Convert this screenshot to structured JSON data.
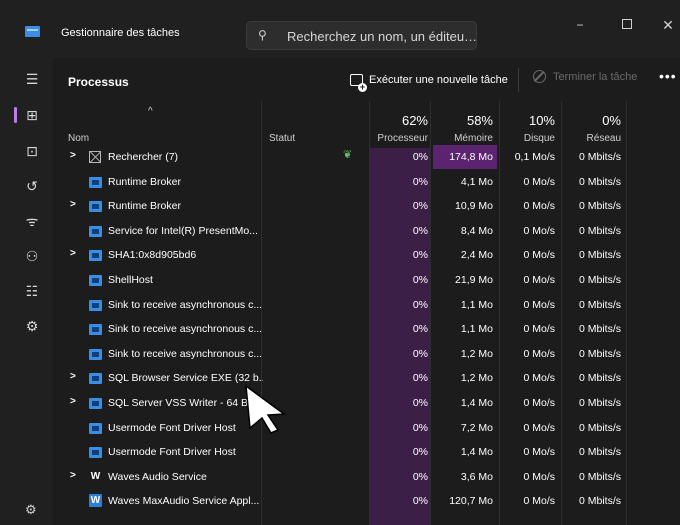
{
  "window": {
    "title": "Gestionnaire des tâches",
    "search_placeholder": "Recherchez un nom, un éditeu…",
    "controls": {
      "minimize": "−",
      "maximize": "",
      "close": "✕"
    }
  },
  "sidebar": {
    "items": [
      {
        "icon": "hamburger-menu-icon",
        "glyph": "☰"
      },
      {
        "icon": "processes-icon",
        "glyph": "⊞"
      },
      {
        "icon": "performance-icon",
        "glyph": "⊡"
      },
      {
        "icon": "app-history-icon",
        "glyph": "↺"
      },
      {
        "icon": "startup-apps-icon",
        "glyph": "ᯤ"
      },
      {
        "icon": "users-icon",
        "glyph": "⚇"
      },
      {
        "icon": "details-icon",
        "glyph": "☷"
      },
      {
        "icon": "services-icon",
        "glyph": "⚙"
      }
    ],
    "settings_icon": "⚙"
  },
  "toolbar": {
    "title": "Processus",
    "run_task": "Exécuter une nouvelle tâche",
    "end_task": "Terminer la tâche",
    "more": "•••"
  },
  "header": {
    "sort_glyph": "^",
    "name": "Nom",
    "status": "Statut",
    "cpu_pct": "62%",
    "cpu_label": "Processeur",
    "mem_pct": "58%",
    "mem_label": "Mémoire",
    "disk_pct": "10%",
    "disk_label": "Disque",
    "net_pct": "0%",
    "net_label": "Réseau"
  },
  "rows": [
    {
      "expand": true,
      "icon": "search",
      "name": "Rechercher (7)",
      "status_icon": true,
      "cpu": "0%",
      "mem": "174,8 Mo",
      "disk": "0,1 Mo/s",
      "net": "0 Mbits/s",
      "mem_highlight": true
    },
    {
      "expand": false,
      "icon": "app",
      "name": "Runtime Broker",
      "cpu": "0%",
      "mem": "4,1 Mo",
      "disk": "0 Mo/s",
      "net": "0 Mbits/s"
    },
    {
      "expand": true,
      "icon": "app",
      "name": "Runtime Broker",
      "cpu": "0%",
      "mem": "10,9 Mo",
      "disk": "0 Mo/s",
      "net": "0 Mbits/s"
    },
    {
      "expand": false,
      "icon": "app",
      "name": "Service for Intel(R) PresentMo...",
      "cpu": "0%",
      "mem": "8,4 Mo",
      "disk": "0 Mo/s",
      "net": "0 Mbits/s"
    },
    {
      "expand": true,
      "icon": "app",
      "name": "SHA1:0x8d905bd6",
      "cpu": "0%",
      "mem": "2,4 Mo",
      "disk": "0 Mo/s",
      "net": "0 Mbits/s"
    },
    {
      "expand": false,
      "icon": "app",
      "name": "ShellHost",
      "cpu": "0%",
      "mem": "21,9 Mo",
      "disk": "0 Mo/s",
      "net": "0 Mbits/s"
    },
    {
      "expand": false,
      "icon": "app",
      "name": "Sink to receive asynchronous c...",
      "cpu": "0%",
      "mem": "1,1 Mo",
      "disk": "0 Mo/s",
      "net": "0 Mbits/s"
    },
    {
      "expand": false,
      "icon": "app",
      "name": "Sink to receive asynchronous c...",
      "cpu": "0%",
      "mem": "1,1 Mo",
      "disk": "0 Mo/s",
      "net": "0 Mbits/s"
    },
    {
      "expand": false,
      "icon": "app",
      "name": "Sink to receive asynchronous c...",
      "cpu": "0%",
      "mem": "1,2 Mo",
      "disk": "0 Mo/s",
      "net": "0 Mbits/s"
    },
    {
      "expand": true,
      "icon": "app",
      "name": "SQL Browser Service EXE (32 b...",
      "cpu": "0%",
      "mem": "1,2 Mo",
      "disk": "0 Mo/s",
      "net": "0 Mbits/s"
    },
    {
      "expand": true,
      "icon": "app",
      "name": "SQL Server VSS Writer - 64 Bit",
      "cpu": "0%",
      "mem": "1,4 Mo",
      "disk": "0 Mo/s",
      "net": "0 Mbits/s"
    },
    {
      "expand": false,
      "icon": "app",
      "name": "Usermode Font Driver Host",
      "cpu": "0%",
      "mem": "7,2 Mo",
      "disk": "0 Mo/s",
      "net": "0 Mbits/s"
    },
    {
      "expand": false,
      "icon": "app",
      "name": "Usermode Font Driver Host",
      "cpu": "0%",
      "mem": "1,4 Mo",
      "disk": "0 Mo/s",
      "net": "0 Mbits/s"
    },
    {
      "expand": true,
      "icon": "waves",
      "name": "Waves Audio Service",
      "cpu": "0%",
      "mem": "3,6 Mo",
      "disk": "0 Mo/s",
      "net": "0 Mbits/s"
    },
    {
      "expand": false,
      "icon": "waves-blue",
      "name": "Waves MaxAudio Service Appl...",
      "cpu": "0%",
      "mem": "120,7 Mo",
      "disk": "0 Mo/s",
      "net": "0 Mbits/s"
    }
  ]
}
